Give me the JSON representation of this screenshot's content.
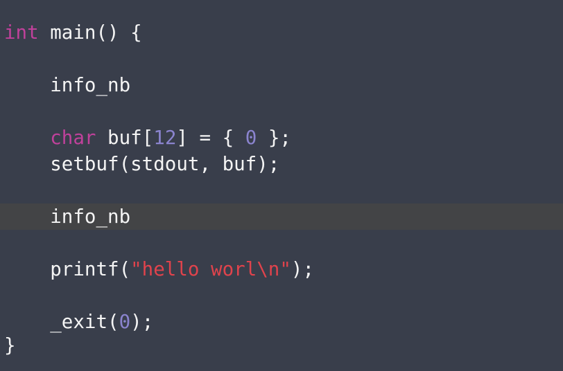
{
  "editor": {
    "theme": {
      "background": "#393e4b",
      "current_line_background": "#434446",
      "text": "#f4f4f4",
      "keyword": "#c0419b",
      "number": "#8b84cf",
      "string": "#e0434c"
    },
    "current_line": 7,
    "lines": [
      {
        "tokens": [
          {
            "type": "keyword",
            "text": "int"
          },
          {
            "type": "plain",
            "text": " main() {"
          }
        ]
      },
      {
        "tokens": []
      },
      {
        "tokens": [
          {
            "type": "plain",
            "text": "    info_nb"
          }
        ]
      },
      {
        "tokens": []
      },
      {
        "tokens": [
          {
            "type": "plain",
            "text": "    "
          },
          {
            "type": "keyword",
            "text": "char"
          },
          {
            "type": "plain",
            "text": " buf["
          },
          {
            "type": "number",
            "text": "12"
          },
          {
            "type": "plain",
            "text": "] = { "
          },
          {
            "type": "number",
            "text": "0"
          },
          {
            "type": "plain",
            "text": " };"
          }
        ]
      },
      {
        "tokens": [
          {
            "type": "plain",
            "text": "    setbuf(stdout, buf);"
          }
        ]
      },
      {
        "tokens": []
      },
      {
        "tokens": [
          {
            "type": "plain",
            "text": "    info_nb"
          }
        ]
      },
      {
        "tokens": []
      },
      {
        "tokens": [
          {
            "type": "plain",
            "text": "    printf("
          },
          {
            "type": "string",
            "text": "\"hello worl\\n\""
          },
          {
            "type": "plain",
            "text": ");"
          }
        ]
      },
      {
        "tokens": []
      },
      {
        "tokens": [
          {
            "type": "plain",
            "text": "    _exit("
          },
          {
            "type": "number",
            "text": "0"
          },
          {
            "type": "plain",
            "text": ");"
          }
        ]
      },
      {
        "tokens": [
          {
            "type": "plain",
            "text": "}"
          }
        ]
      }
    ]
  }
}
